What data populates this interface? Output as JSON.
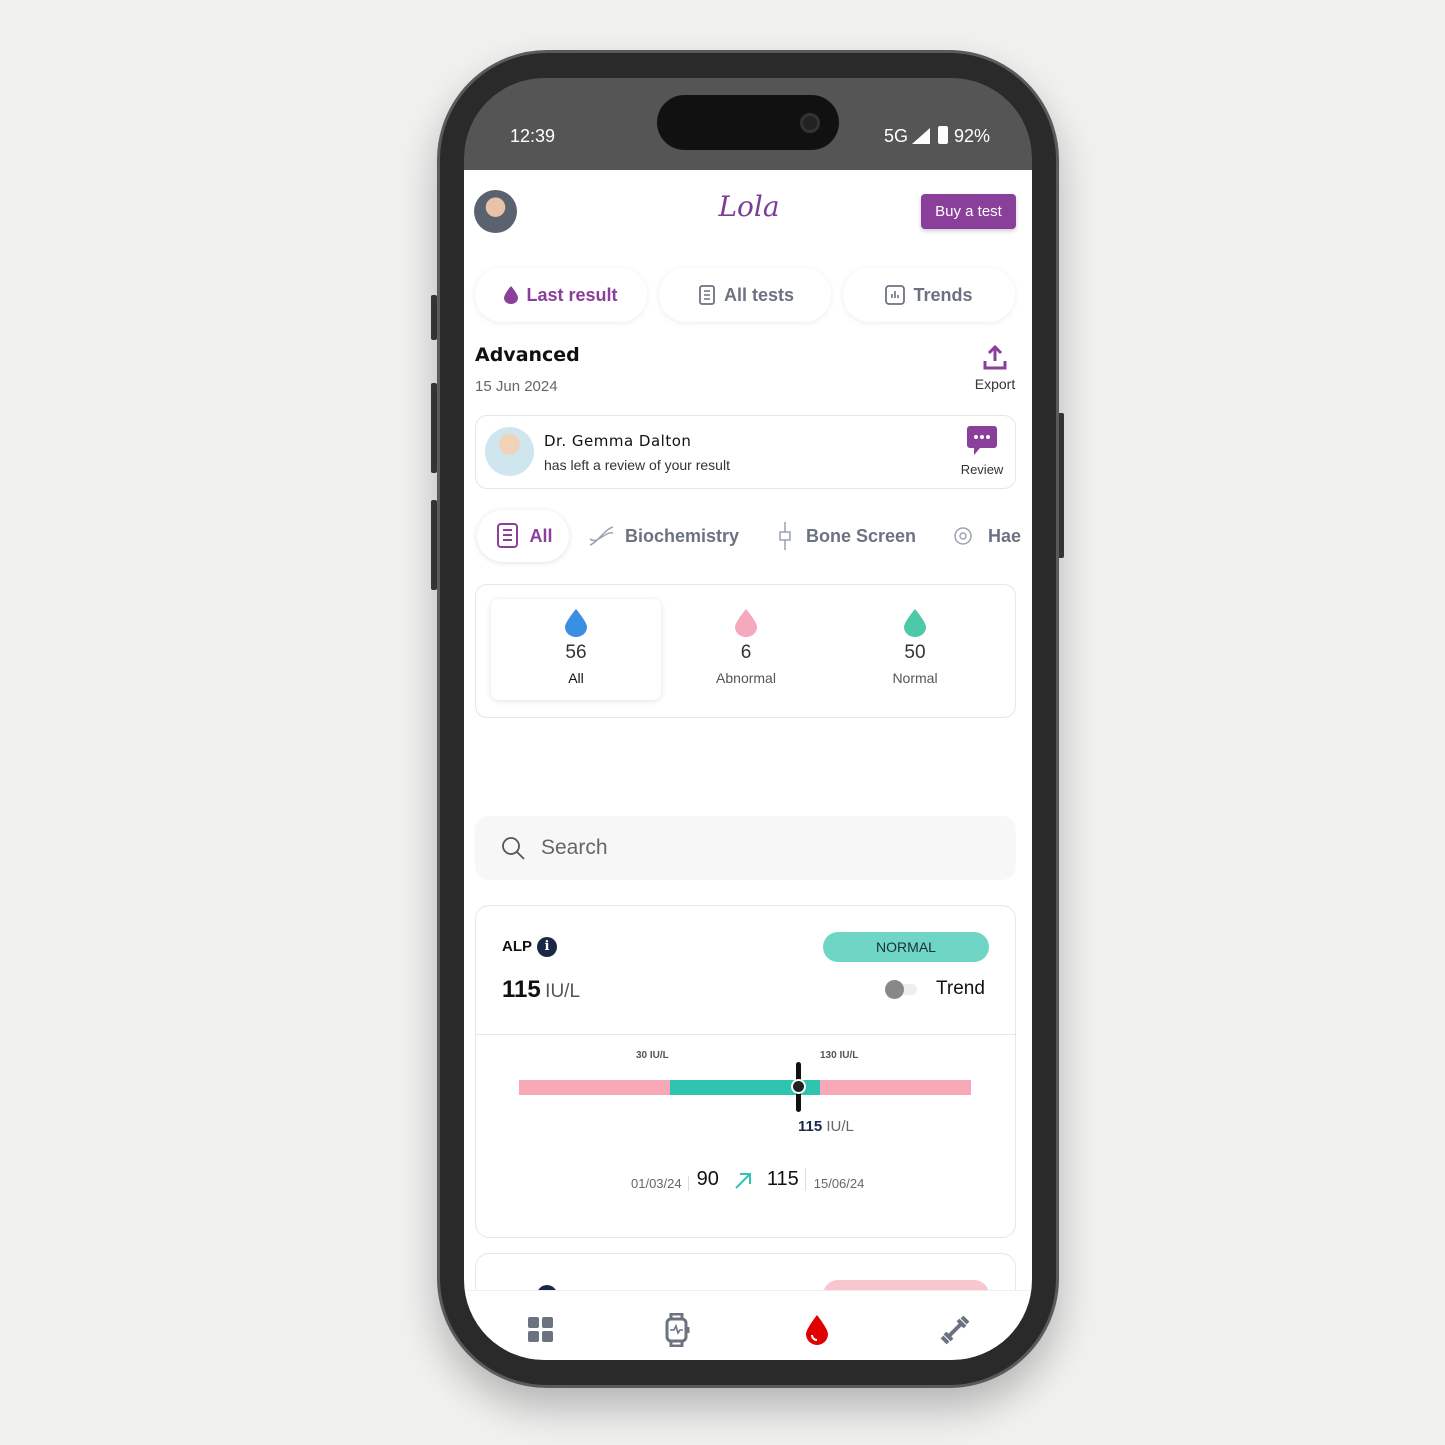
{
  "status_bar": {
    "time": "12:39",
    "network": "5G",
    "battery": "92%"
  },
  "header": {
    "logo": "Lola",
    "buy_label": "Buy a test"
  },
  "tabs": [
    {
      "label": "Last result",
      "active": true
    },
    {
      "label": "All tests"
    },
    {
      "label": "Trends"
    }
  ],
  "report": {
    "title": "Advanced",
    "date": "15 Jun 2024",
    "export_label": "Export"
  },
  "review": {
    "doctor": "Dr. Gemma Dalton",
    "message": "has left a review of your result",
    "action": "Review"
  },
  "categories": [
    {
      "label": "All",
      "active": true
    },
    {
      "label": "Biochemistry"
    },
    {
      "label": "Bone Screen"
    },
    {
      "label": "Hae"
    }
  ],
  "summary": [
    {
      "count": "56",
      "label": "All",
      "color": "#3b8fe0"
    },
    {
      "count": "6",
      "label": "Abnormal",
      "color": "#f6a9bd"
    },
    {
      "count": "50",
      "label": "Normal",
      "color": "#4cc9a7"
    }
  ],
  "search": {
    "placeholder": "Search"
  },
  "result": {
    "name": "ALP",
    "value": "115",
    "unit": "IU/L",
    "status": "NORMAL",
    "trend_label": "Trend",
    "trend_on": false,
    "range_low": "30 IU/L",
    "range_high": "130 IU/L",
    "marker_value": "115",
    "marker_unit": "IU/L",
    "prev_date": "01/03/24",
    "prev_value": "90",
    "curr_value": "115",
    "curr_date": "15/06/24"
  },
  "colors": {
    "brand": "#8a3f9a",
    "normal": "#2ec4b0",
    "abnormal": "#f9a8b8",
    "active_nav": "#e00000"
  },
  "bottom_nav": [
    {
      "icon": "grid-icon"
    },
    {
      "icon": "smartwatch-icon"
    },
    {
      "icon": "blood-drop-icon",
      "active": true
    },
    {
      "icon": "dumbbell-icon"
    }
  ]
}
